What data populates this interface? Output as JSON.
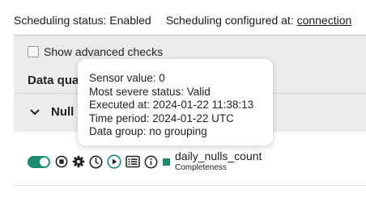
{
  "scheduling": {
    "status_text": "Scheduling status: Enabled",
    "configured_label": "Scheduling configured at:",
    "configured_link": "connection"
  },
  "panel": {
    "advanced_checks_label": "Show advanced checks",
    "advanced_checks_checked": false,
    "header_visible_text": "Data qua",
    "group_visible_text": "Null"
  },
  "check": {
    "enabled": true,
    "name": "daily_nulls_count",
    "category": "Completeness",
    "status_color": "#1f8a70",
    "icons": [
      "toggle-icon",
      "stop-icon",
      "gear-icon",
      "clock-icon",
      "play-icon",
      "list-icon",
      "info-icon",
      "status-square-icon"
    ]
  },
  "tooltip": {
    "sensor_value": "Sensor value: 0",
    "severity": "Most severe status: Valid",
    "executed_at": "Executed at: 2024-01-22 11:38:13",
    "time_period": "Time period: 2024-01-22 UTC",
    "data_group": "Data group: no grouping"
  },
  "colors": {
    "accent": "#1f8a70",
    "panel_bg": "#ececec"
  }
}
